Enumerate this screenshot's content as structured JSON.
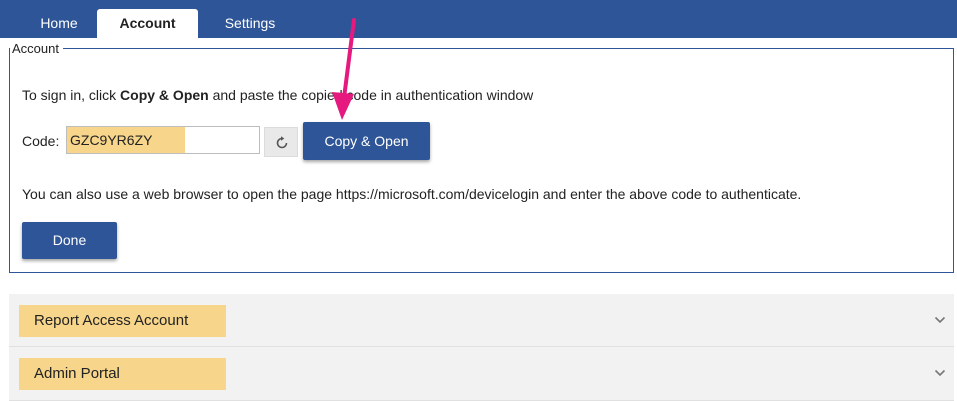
{
  "tabs": [
    {
      "label": "Home",
      "active": false
    },
    {
      "label": "Account",
      "active": true
    },
    {
      "label": "Settings",
      "active": false
    }
  ],
  "account": {
    "legend": "Account",
    "instruction": {
      "prefix": "To sign in, click ",
      "bold": "Copy & Open",
      "suffix": " and paste the copied code in authentication window"
    },
    "code_label": "Code:",
    "code_value": "GZC9YR6ZY",
    "refresh_icon": "refresh-icon",
    "copy_open_label": "Copy & Open",
    "browser_note": "You can also use a web browser to open the page https://microsoft.com/devicelogin and enter the above code to authenticate.",
    "done_label": "Done"
  },
  "sections": [
    {
      "label": "Report Access Account",
      "icon": "chevron-down-icon"
    },
    {
      "label": "Admin Portal",
      "icon": "chevron-down-icon"
    }
  ],
  "colors": {
    "brand": "#2e5597",
    "highlight": "#f7d58a",
    "annotation_arrow": "#e5197e"
  }
}
